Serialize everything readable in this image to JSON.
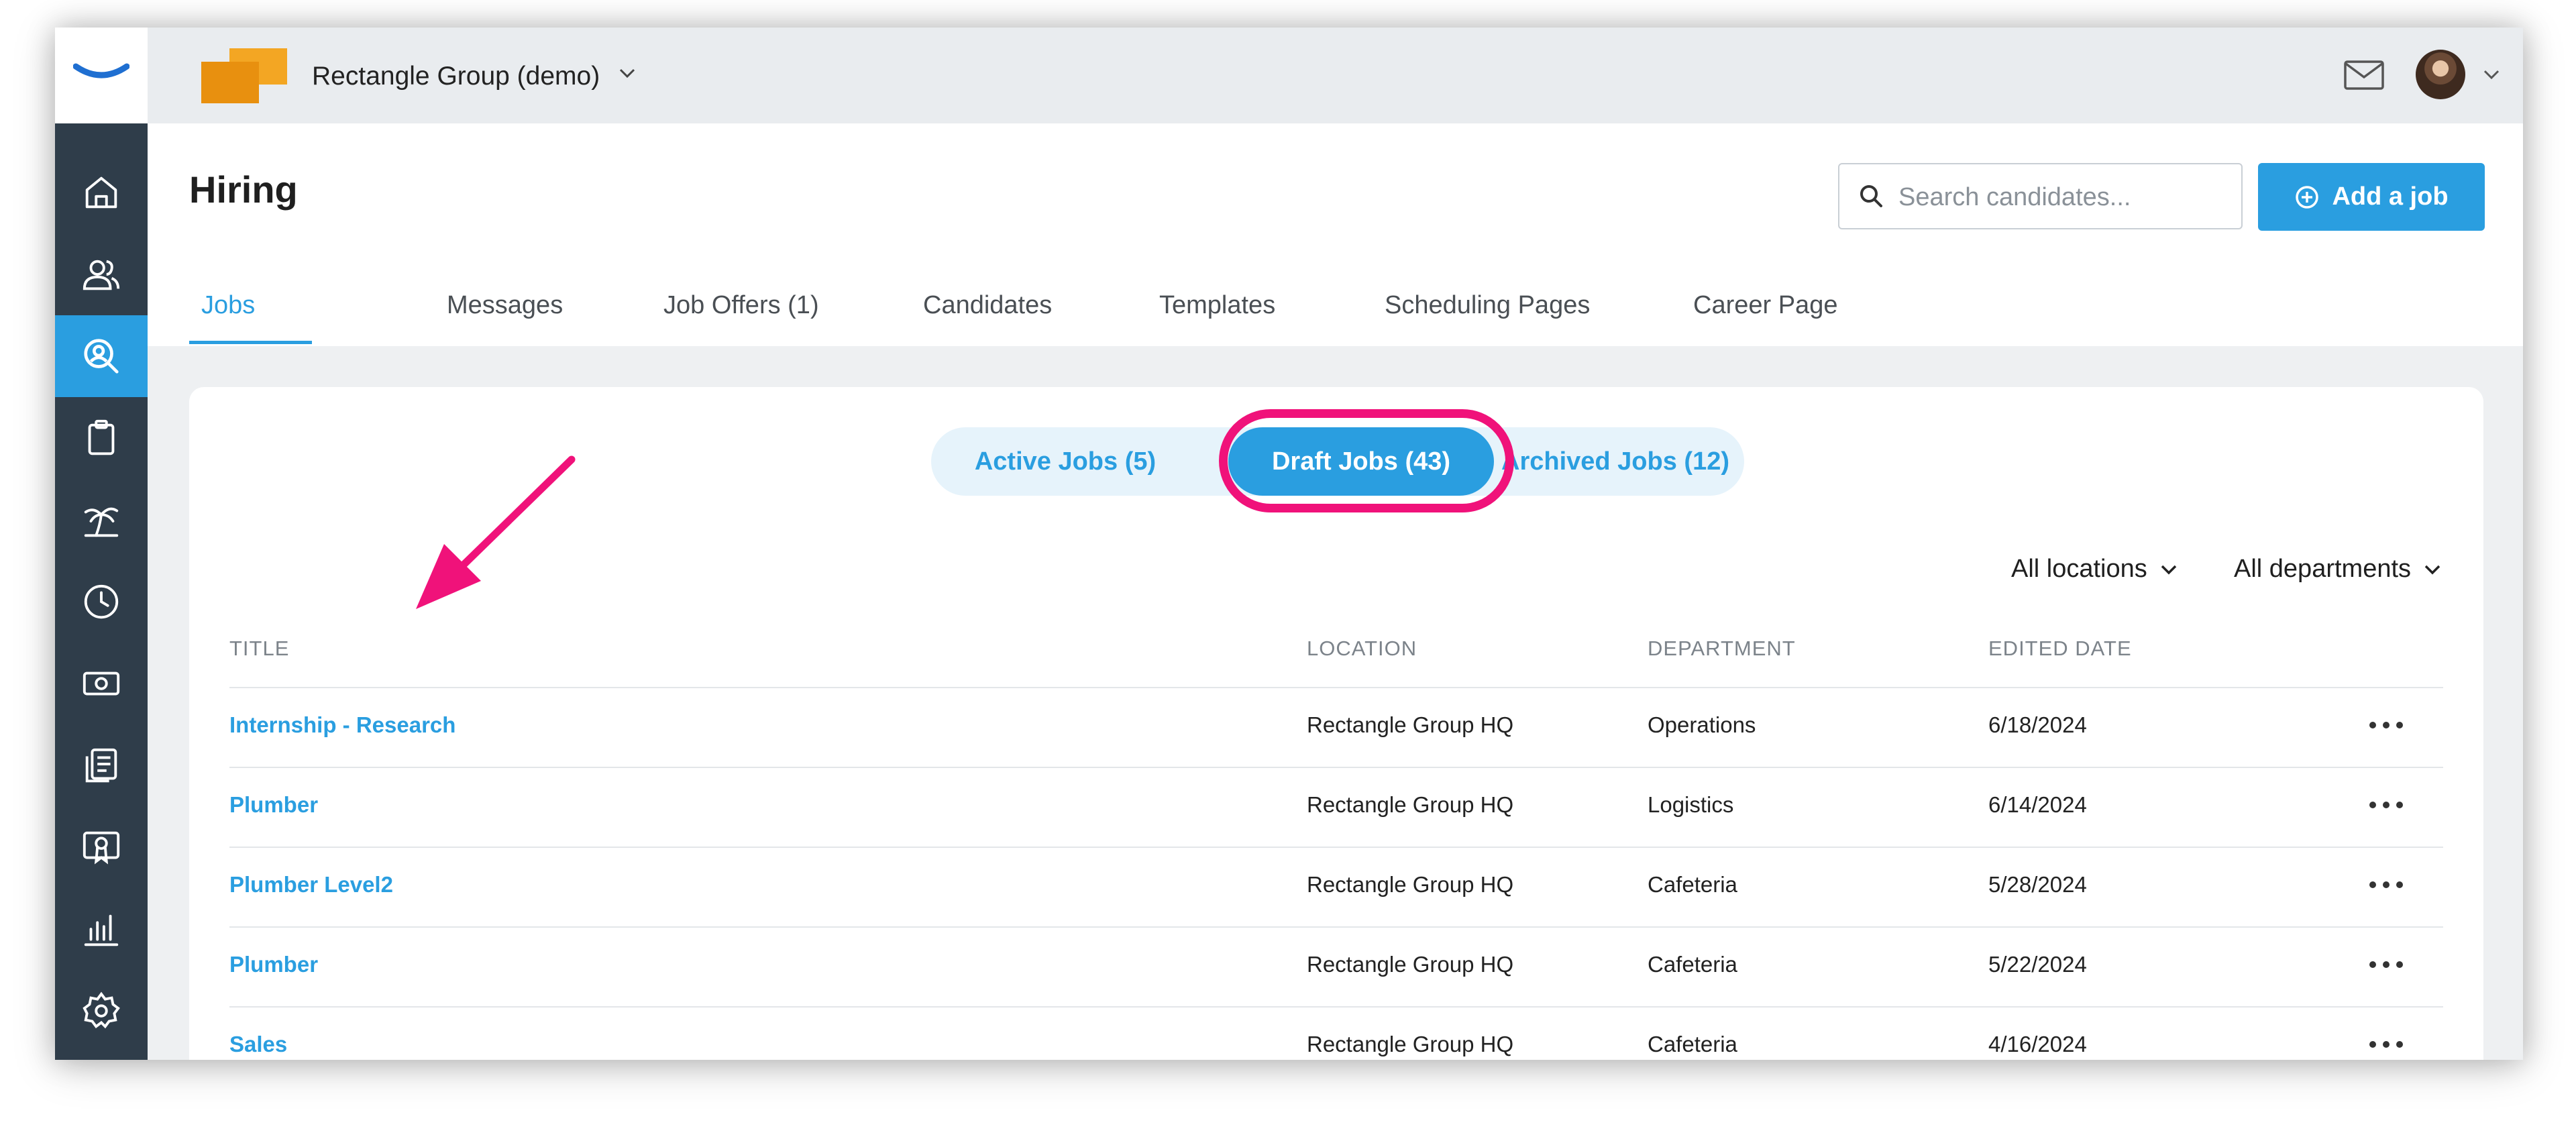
{
  "org": {
    "name": "Rectangle Group (demo)"
  },
  "page": {
    "title": "Hiring"
  },
  "search": {
    "placeholder": "Search candidates..."
  },
  "actions": {
    "add_job_label": "Add a job"
  },
  "tabs": [
    {
      "label": "Jobs",
      "active": true
    },
    {
      "label": "Messages"
    },
    {
      "label": "Job Offers (1)"
    },
    {
      "label": "Candidates"
    },
    {
      "label": "Templates"
    },
    {
      "label": "Scheduling Pages"
    },
    {
      "label": "Career Page"
    }
  ],
  "job_status": [
    {
      "label": "Active Jobs (5)"
    },
    {
      "label": "Draft Jobs (43)",
      "selected": true
    },
    {
      "label": "Archived Jobs (12)"
    }
  ],
  "filters": {
    "location": "All locations",
    "department": "All departments"
  },
  "table": {
    "columns": [
      "TITLE",
      "LOCATION",
      "DEPARTMENT",
      "EDITED DATE"
    ],
    "rows": [
      {
        "title": "Internship - Research",
        "location": "Rectangle Group HQ",
        "department": "Operations",
        "edited": "6/18/2024"
      },
      {
        "title": "Plumber",
        "location": "Rectangle Group HQ",
        "department": "Logistics",
        "edited": "6/14/2024"
      },
      {
        "title": "Plumber Level2",
        "location": "Rectangle Group HQ",
        "department": "Cafeteria",
        "edited": "5/28/2024"
      },
      {
        "title": "Plumber",
        "location": "Rectangle Group HQ",
        "department": "Cafeteria",
        "edited": "5/22/2024"
      },
      {
        "title": "Sales",
        "location": "Rectangle Group HQ",
        "department": "Cafeteria",
        "edited": "4/16/2024"
      }
    ]
  },
  "sidebar": {
    "items": [
      {
        "icon": "home-icon"
      },
      {
        "icon": "people-icon"
      },
      {
        "icon": "hiring-search-icon",
        "active": true
      },
      {
        "icon": "clipboard-icon"
      },
      {
        "icon": "palm-tree-icon"
      },
      {
        "icon": "clock-icon"
      },
      {
        "icon": "money-icon"
      },
      {
        "icon": "documents-icon"
      },
      {
        "icon": "certificate-icon"
      },
      {
        "icon": "bar-chart-icon"
      },
      {
        "icon": "gear-icon"
      },
      {
        "icon": "help-icon"
      }
    ]
  },
  "colors": {
    "accent": "#2a9ee0",
    "sidebar": "#2f3d4a",
    "highlight": "#f0127a",
    "org_logo": "#f0a020"
  }
}
